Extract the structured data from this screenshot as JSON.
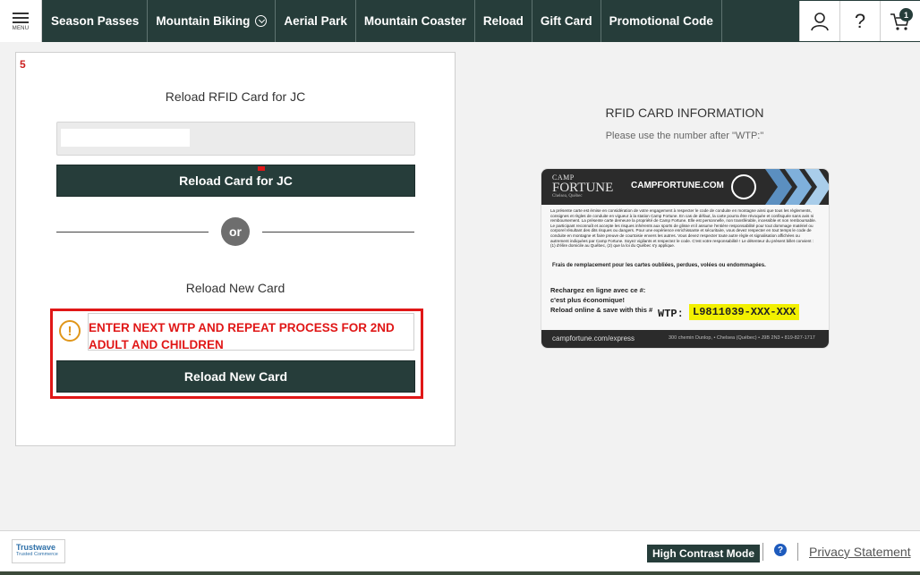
{
  "nav": {
    "menu_label": "MENU",
    "items": [
      {
        "label": "Season Passes"
      },
      {
        "label": "Mountain Biking"
      },
      {
        "label": "Aerial Park"
      },
      {
        "label": "Mountain Coaster"
      },
      {
        "label": "Reload"
      },
      {
        "label": "Gift Card"
      },
      {
        "label": "Promotional Code"
      }
    ],
    "help_label": "?",
    "cart_count": "1"
  },
  "left": {
    "step": "5",
    "reload_title": "Reload RFID Card for JC",
    "reload_button": "Reload Card for JC",
    "or_label": "or",
    "new_card_title": "Reload New Card",
    "warning_icon": "!",
    "note": "ENTER NEXT WTP AND REPEAT PROCESS FOR 2ND ADULT AND CHILDREN",
    "new_card_button": "Reload New Card"
  },
  "rfid": {
    "title": "RFID CARD INFORMATION",
    "subtitle": "Please use the number after \"WTP:\"",
    "card": {
      "logo_top": "CAMP",
      "logo_main": "FORTUNE",
      "logo_loc": "Chelsea, Québec",
      "site": "CAMPFORTUNE.COM",
      "fine_print": "La présente carte est émise en considération de votre engagement à respecter le code de conduite en montagne ainsi que tous les règlements, consignes et règles de conduite en vigueur à la station Camp Fortune. En cas de défaut, la carte pourra être révoquée et confisquée sans avis ni remboursement. La présente carte demeure la propriété de Camp Fortune. Elle est personnelle, non transférable, incessible et non remboursable. Le participant reconnaît et accepte les risques inhérents aux sports de glisse et il assume l'entière responsabilité pour tout dommage matériel ou corporel résultant des dits risques ou dangers. Pour une expérience enrichissante et sécuritaire, vous devez respecter en tout temps le code de conduite en montagne et faire preuve de courtoisie envers les autres. Vous devez respecter toute autre règle et signalisation affichées ou autrement indiquées par Camp Fortune. Soyez vigilants et respectez le code. C'est votre responsabilité ! Le détenteur du présent billet convient : (1) d'élire domicile au Québec, (2) que la loi du Québec s'y applique.",
      "fine_bold": "Frais de remplacement pour les cartes oubliées, perdues, volées ou endommagées.",
      "reload_line1": "Rechargez en ligne avec ce #:",
      "reload_line2": "c'est plus économique!",
      "reload_line3": "Reload online & save with this #",
      "wtp_label": "WTP:",
      "wtp_value": "L9811039-XXX-XXX",
      "foot_url": "campfortune.com/express",
      "foot_addr": "300 chemin Dunlop, • Chelsea (Québec) • J9B 2N3 • 819-827-1717"
    }
  },
  "footer": {
    "trustwave": "Trustwave",
    "trusted": "Trusted Commerce",
    "high_contrast": "High Contrast Mode",
    "help": "?",
    "privacy": "Privacy Statement"
  }
}
